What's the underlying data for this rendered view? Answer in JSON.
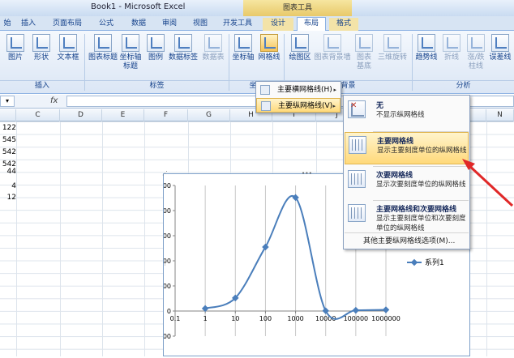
{
  "window": {
    "title": "Book1 - Microsoft Excel",
    "context_tab_group": "图表工具"
  },
  "tabs": [
    "始",
    "插入",
    "页面布局",
    "公式",
    "数据",
    "审阅",
    "视图",
    "开发工具",
    "设计",
    "布局",
    "格式"
  ],
  "ribbon": {
    "buttons": {
      "picture": "图片",
      "shapes": "形状",
      "textbox": "文本框",
      "chart_title": "图表标题",
      "axis_titles": "坐标轴标题",
      "legend": "图例",
      "data_labels": "数据标签",
      "data_table": "数据表",
      "axes": "坐标轴",
      "gridlines": "网格线",
      "plot_area": "绘图区",
      "chart_wall": "图表背景墙",
      "chart_floor": "图表基底",
      "rotation_3d": "三维旋转",
      "trendline": "趋势线",
      "lines": "折线",
      "updown_bars": "涨/跌柱线",
      "error_bars": "误差线"
    },
    "groups": {
      "insert": "插入",
      "labels": "标签",
      "axes_group": "坐标",
      "background": "背景",
      "analysis": "分析"
    }
  },
  "formula_bar": {
    "fx": "fx",
    "value": ""
  },
  "columns": [
    "C",
    "D",
    "E",
    "F",
    "G",
    "H",
    "I",
    "J",
    "K",
    "L",
    "M",
    "N"
  ],
  "cells_col_b": [
    "122",
    "545",
    "542",
    "542",
    "545",
    "44",
    "4",
    "12"
  ],
  "gridlines_menu": {
    "items": [
      {
        "label": "主要横网格线(H)",
        "arrow": "▸"
      },
      {
        "label": "主要纵网格线(V)",
        "arrow": "▸"
      }
    ]
  },
  "vertical_gridlines_submenu": {
    "items": [
      {
        "title": "无",
        "desc": "不显示纵网格线"
      },
      {
        "title": "主要网格线",
        "desc": "显示主要刻度单位的纵网格线"
      },
      {
        "title": "次要网格线",
        "desc": "显示次要刻度单位的纵网格线"
      },
      {
        "title": "主要网格线和次要网格线",
        "desc": "显示主要刻度单位和次要刻度单位的纵网格线"
      }
    ],
    "more": "其他主要纵网格线选项(M)..."
  },
  "chart_data": {
    "type": "line",
    "title": "",
    "xlabel": "",
    "ylabel": "",
    "x_scale": "log",
    "x_tick_labels": [
      "0.1",
      "1",
      "10",
      "100",
      "1000",
      "10000",
      "100000",
      "1000000"
    ],
    "y_ticks": [
      -1000,
      0,
      1000,
      2000,
      3000,
      4000,
      5000
    ],
    "ylim": [
      -1000,
      5000
    ],
    "xlim": [
      0.1,
      1000000
    ],
    "grid": "vertical",
    "legend_position": "right",
    "series": [
      {
        "name": "系列1",
        "color": "#4a7ebb",
        "x": [
          1,
          10,
          100,
          1000,
          10000,
          100000,
          1000000
        ],
        "y": [
          100,
          520,
          2550,
          4520,
          10,
          30,
          50
        ]
      }
    ]
  },
  "colors": {
    "highlight": "#ffd97a",
    "series": "#4a7ebb",
    "arrow": "#e02828"
  }
}
